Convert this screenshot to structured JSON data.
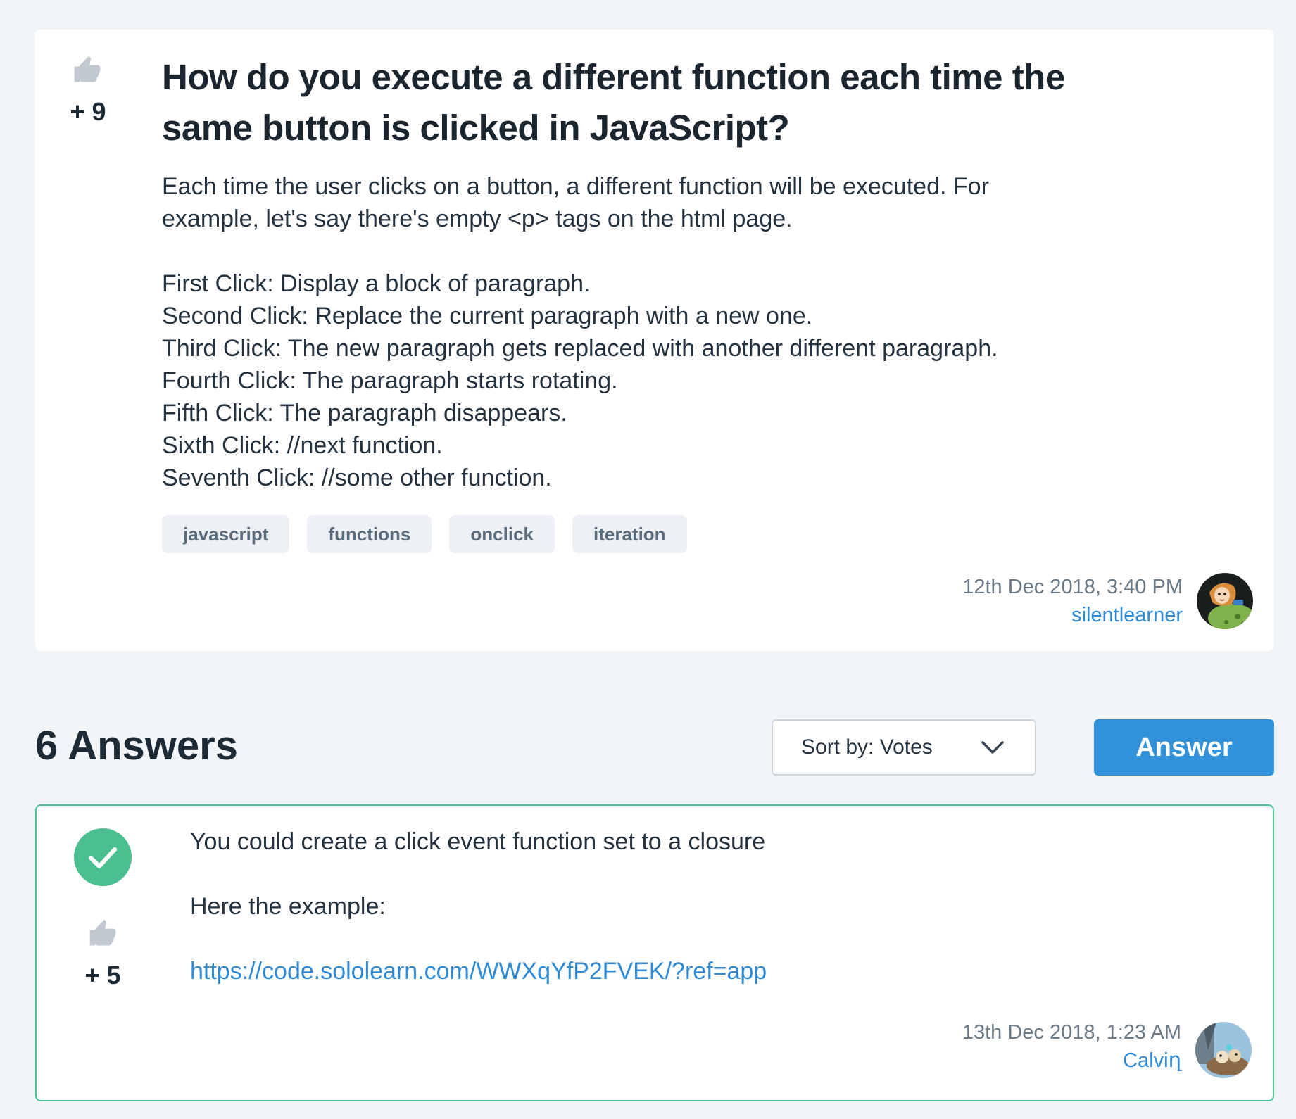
{
  "question": {
    "votes": "+ 9",
    "title": "How do you execute a different function each time the same button is clicked in JavaScript?",
    "body_intro": [
      "Each time the user clicks on a button, a different function will be executed. For",
      "example, let's say there's empty <p> tags on the html page."
    ],
    "body_steps": [
      "First Click: Display a block of paragraph.",
      "Second Click: Replace the current paragraph with a new one.",
      "Third Click: The new paragraph gets replaced with another different paragraph.",
      "Fourth Click: The paragraph starts rotating.",
      "Fifth Click: The paragraph disappears.",
      "Sixth Click: //next function.",
      "Seventh Click: //some other function."
    ],
    "tags": [
      "javascript",
      "functions",
      "onclick",
      "iteration"
    ],
    "date": "12th Dec 2018, 3:40 PM",
    "author": "silentlearner"
  },
  "answers_section": {
    "heading": "6 Answers",
    "sort_label": "Sort by: Votes",
    "answer_button": "Answer"
  },
  "answer": {
    "votes": "+ 5",
    "line1": "You could create a click event function set to a closure",
    "line2": "Here the example:",
    "link": "https://code.sololearn.com/WWXqYfP2FVEK/?ref=app",
    "date": "13th Dec 2018, 1:23 AM",
    "author": "Calviղ"
  },
  "colors": {
    "accent": "#3191d9",
    "accepted": "#4bbf8f",
    "link": "#2f8ad6"
  }
}
